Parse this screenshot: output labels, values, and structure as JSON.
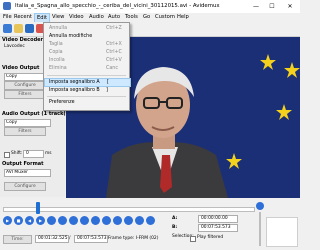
{
  "window": {
    "title": "Italia_e_Spagna_allo_specchio_-_ceriba_del_vicini_30112015.avi - Avidemux",
    "minimize": "—",
    "maximize": "☐",
    "close": "✕"
  },
  "menubar": {
    "items": [
      "File",
      "Recent",
      "Edit",
      "View",
      "Video",
      "Audio",
      "Auto",
      "Tools",
      "Go",
      "Custom",
      "Help"
    ]
  },
  "edit_menu": {
    "items": [
      {
        "label": "Annulla",
        "shortcut": "Ctrl+Z"
      },
      {
        "label": "Annulla modifiche",
        "shortcut": ""
      },
      {
        "label": "Taglia",
        "shortcut": "Ctrl+X"
      },
      {
        "label": "Copia",
        "shortcut": "Ctrl+C"
      },
      {
        "label": "Incolla",
        "shortcut": "Ctrl+V"
      },
      {
        "label": "Elimina",
        "shortcut": "Canc"
      },
      {
        "label": "Imposta segnalibro A",
        "shortcut": "["
      },
      {
        "label": "Imposta segnalibro B",
        "shortcut": "]"
      },
      {
        "label": "Preferenze",
        "shortcut": ""
      }
    ]
  },
  "left_panel": {
    "video_decoder_title": "Video Decoder",
    "video_decoder_value": "Lavcodec",
    "video_output_title": "Video Output",
    "video_output_value": "Copy",
    "configure_label": "Configure",
    "filters_label": "Filters",
    "audio_output_title": "Audio Output (1 track(s))",
    "audio_output_value": "Copy",
    "filters_label_2": "Filters",
    "shift_label": "Shift:",
    "shift_value": "0",
    "shift_unit": "ms",
    "output_format_title": "Output Format",
    "output_format_value": "AVI Muxer",
    "configure_label_2": "Configure"
  },
  "bottom": {
    "time_button": "Time:",
    "current_time": "00:01:32.525",
    "slash": "/",
    "total_time": "00:07:53.573",
    "frame_type": "Frame type:  I-FRM (02)",
    "a_label": "A:",
    "a_value": "00:00:00.00",
    "b_label": "B:",
    "b_value": "00:07:53.573",
    "selection_label": "Selection:",
    "play_filtered": "Play filtered"
  },
  "icons": {
    "play": "▶",
    "stop": "■",
    "prev": "◀",
    "next": "▶"
  },
  "colors": {
    "accent": "#2f6fd8",
    "menu_highlight": "#cde8ff",
    "video_background": "#1b2f77"
  }
}
